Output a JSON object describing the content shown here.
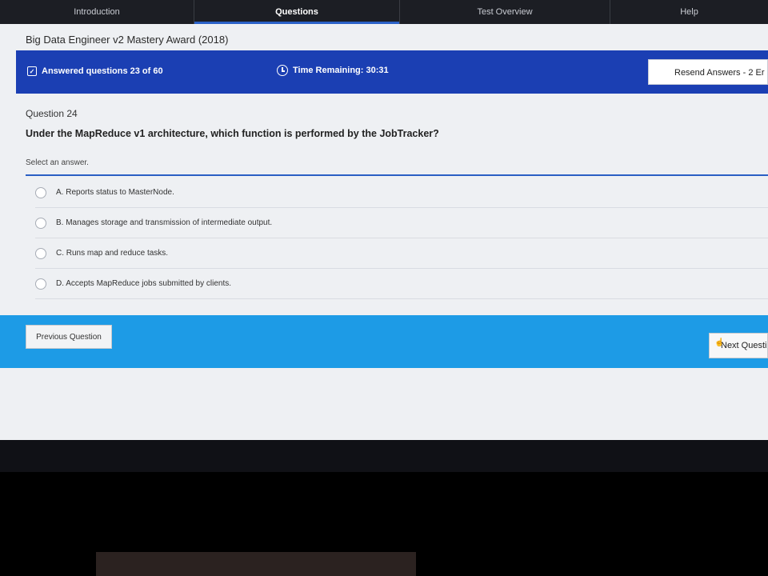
{
  "nav": {
    "tabs": [
      {
        "label": "Introduction"
      },
      {
        "label": "Questions"
      },
      {
        "label": "Test Overview"
      },
      {
        "label": "Help"
      }
    ]
  },
  "exam": {
    "title": "Big Data Engineer v2 Mastery Award (2018)"
  },
  "status": {
    "answered_text": "Answered questions 23 of 60",
    "time_text": "Time Remaining: 30:31",
    "resend_label": "Resend Answers - 2 Er"
  },
  "question": {
    "number_label": "Question 24",
    "text": "Under the MapReduce v1 architecture, which function is performed by the JobTracker?",
    "hint": "Select an answer.",
    "options": [
      {
        "label": "A.  Reports status to MasterNode."
      },
      {
        "label": "B.  Manages storage and transmission of intermediate output."
      },
      {
        "label": "C.  Runs map and reduce tasks."
      },
      {
        "label": "D.  Accepts MapReduce jobs submitted by clients."
      }
    ]
  },
  "footer": {
    "prev_label": "Previous Question",
    "next_label": "Next Questi"
  },
  "colors": {
    "status_bar": "#1b3fb3",
    "nav_bar": "#1d9be6",
    "active_tab_accent": "#2b62c8"
  }
}
